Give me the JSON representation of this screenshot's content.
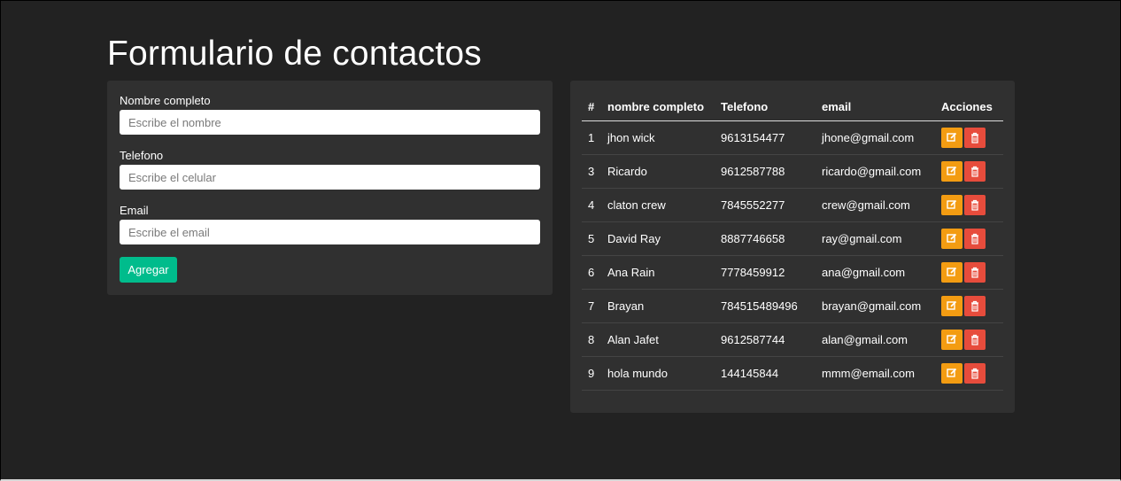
{
  "page": {
    "title": "Formulario de contactos"
  },
  "form": {
    "name_label": "Nombre completo",
    "name_placeholder": "Escribe el nombre",
    "phone_label": "Telefono",
    "phone_placeholder": "Escribe el celular",
    "email_label": "Email",
    "email_placeholder": "Escribe el email",
    "submit_label": "Agregar"
  },
  "table": {
    "headers": [
      "#",
      "nombre completo",
      "Telefono",
      "email",
      "Acciones"
    ],
    "rows": [
      {
        "id": "1",
        "name": "jhon wick",
        "phone": "9613154477",
        "email": "jhone@gmail.com"
      },
      {
        "id": "3",
        "name": "Ricardo",
        "phone": "9612587788",
        "email": "ricardo@gmail.com"
      },
      {
        "id": "4",
        "name": "claton crew",
        "phone": "7845552277",
        "email": "crew@gmail.com"
      },
      {
        "id": "5",
        "name": "David Ray",
        "phone": "8887746658",
        "email": "ray@gmail.com"
      },
      {
        "id": "6",
        "name": "Ana Rain",
        "phone": "7778459912",
        "email": "ana@gmail.com"
      },
      {
        "id": "7",
        "name": "Brayan",
        "phone": "784515489496",
        "email": "brayan@gmail.com"
      },
      {
        "id": "8",
        "name": "Alan Jafet",
        "phone": "9612587744",
        "email": "alan@gmail.com"
      },
      {
        "id": "9",
        "name": "hola mundo",
        "phone": "144145844",
        "email": "mmm@email.com"
      }
    ],
    "row_actions": {
      "edit_icon": "edit-icon",
      "delete_icon": "trash-icon"
    }
  },
  "colors": {
    "background": "#222222",
    "card": "#303030",
    "primary_button": "#00bc8c",
    "edit_button": "#f39c12",
    "delete_button": "#e74c3c"
  }
}
